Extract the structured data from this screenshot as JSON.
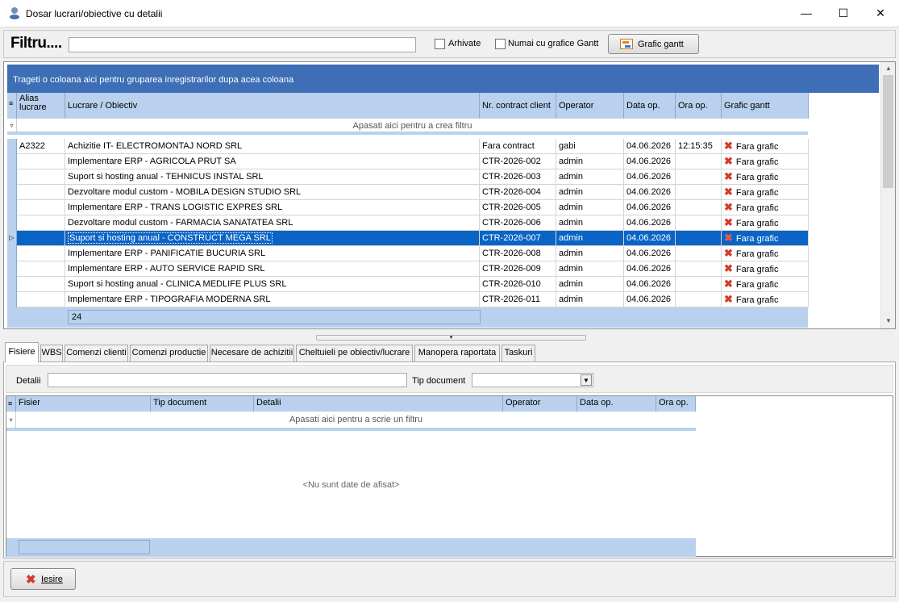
{
  "window": {
    "title": "Dosar lucrari/obiective cu detalii",
    "minimize": "—",
    "maximize": "☐",
    "close": "✕"
  },
  "filterbar": {
    "label": "Filtru....",
    "search_value": "",
    "arhivate_label": "Arhivate",
    "arhivate_checked": false,
    "gantt_only_label": "Numai cu grafice Gantt",
    "gantt_only_checked": false,
    "gantt_button_label": "Grafic gantt"
  },
  "grid": {
    "group_panel_text": "Trageti o coloana aici pentru gruparea inregistrarilor dupa acea coloana",
    "columns": {
      "alias": "Alias\nlucrare",
      "lucrare": "Lucrare / Obiectiv",
      "contract": "Nr. contract client",
      "operator": "Operator",
      "data": "Data op.",
      "ora": "Ora op.",
      "gantt": "Grafic gantt"
    },
    "filter_row_text": "Apasati aici pentru a  crea filtru",
    "rows": [
      {
        "alias": "A2322",
        "lucrare": "Achizitie IT- ELECTROMONTAJ NORD SRL",
        "contract": "Fara contract",
        "operator": "gabi",
        "data": "04.06.2026",
        "ora": "12:15:35",
        "gantt": "Fara grafic"
      },
      {
        "alias": "",
        "lucrare": "Implementare ERP - AGRICOLA PRUT SA",
        "contract": "CTR-2026-002",
        "operator": "admin",
        "data": "04.06.2026",
        "ora": "",
        "gantt": "Fara grafic"
      },
      {
        "alias": "",
        "lucrare": "Suport si hosting anual - TEHNICUS INSTAL SRL",
        "contract": "CTR-2026-003",
        "operator": "admin",
        "data": "04.06.2026",
        "ora": "",
        "gantt": "Fara grafic"
      },
      {
        "alias": "",
        "lucrare": "Dezvoltare modul custom - MOBILA DESIGN STUDIO SRL",
        "contract": "CTR-2026-004",
        "operator": "admin",
        "data": "04.06.2026",
        "ora": "",
        "gantt": "Fara grafic"
      },
      {
        "alias": "",
        "lucrare": "Implementare ERP - TRANS LOGISTIC EXPRES SRL",
        "contract": "CTR-2026-005",
        "operator": "admin",
        "data": "04.06.2026",
        "ora": "",
        "gantt": "Fara grafic"
      },
      {
        "alias": "",
        "lucrare": "Dezvoltare modul custom - FARMACIA SANATATEA SRL",
        "contract": "CTR-2026-006",
        "operator": "admin",
        "data": "04.06.2026",
        "ora": "",
        "gantt": "Fara grafic"
      },
      {
        "alias": "",
        "lucrare": "Suport si hosting anual - CONSTRUCT MEGA SRL",
        "contract": "CTR-2026-007",
        "operator": "admin",
        "data": "04.06.2026",
        "ora": "",
        "gantt": "Fara grafic",
        "selected": true
      },
      {
        "alias": "",
        "lucrare": "Implementare ERP - PANIFICATIE BUCURIA SRL",
        "contract": "CTR-2026-008",
        "operator": "admin",
        "data": "04.06.2026",
        "ora": "",
        "gantt": "Fara grafic"
      },
      {
        "alias": "",
        "lucrare": "Implementare ERP - AUTO SERVICE RAPID SRL",
        "contract": "CTR-2026-009",
        "operator": "admin",
        "data": "04.06.2026",
        "ora": "",
        "gantt": "Fara grafic"
      },
      {
        "alias": "",
        "lucrare": "Suport si hosting anual - CLINICA MEDLIFE PLUS SRL",
        "contract": "CTR-2026-010",
        "operator": "admin",
        "data": "04.06.2026",
        "ora": "",
        "gantt": "Fara grafic"
      },
      {
        "alias": "",
        "lucrare": "Implementare ERP - TIPOGRAFIA MODERNA SRL",
        "contract": "CTR-2026-011",
        "operator": "admin",
        "data": "04.06.2026",
        "ora": "",
        "gantt": "Fara grafic"
      }
    ],
    "record_count": "24"
  },
  "tabs": [
    {
      "label": "Fisiere",
      "active": true
    },
    {
      "label": "WBS"
    },
    {
      "label": "Comenzi clienti"
    },
    {
      "label": "Comenzi productie"
    },
    {
      "label": "Necesare de achizitii"
    },
    {
      "label": "Cheltuieli pe obiectiv/lucrare"
    },
    {
      "label": "Manopera raportata"
    },
    {
      "label": "Taskuri"
    }
  ],
  "details": {
    "detalii_label": "Detalii",
    "detalii_value": "",
    "tip_label": "Tip document",
    "tip_value": ""
  },
  "files_grid": {
    "columns": {
      "fisier": "Fisier",
      "tip": "Tip document",
      "detalii": "Detalii",
      "operator": "Operator",
      "data": "Data op.",
      "ora": "Ora op."
    },
    "filter_row_text": "Apasati aici pentru a scrie un filtru",
    "empty_text": "<Nu sunt date de afisat>"
  },
  "bottom": {
    "iesire_label": "Iesire"
  },
  "colors": {
    "group_panel": "#3d6eb6",
    "header": "#b9d1ee",
    "selection": "#0a64c6",
    "error_x": "#d43b2a"
  }
}
